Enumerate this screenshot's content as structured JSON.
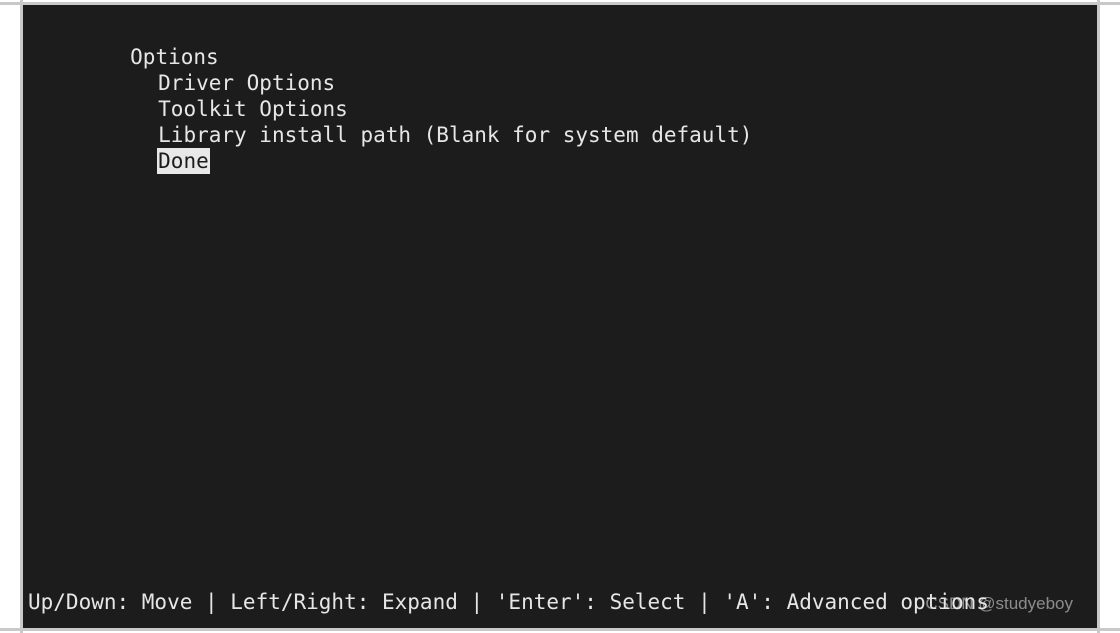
{
  "terminal": {
    "background_color": "#1c1c1c",
    "text_color": "#e6e6e6",
    "border_color": "#c9c9c9",
    "highlight_background": "#e8e8e8",
    "highlight_text_color": "#1c1c1c"
  },
  "menu": {
    "title": "Options",
    "items": [
      {
        "label": "Options",
        "indent": 0,
        "selected": false
      },
      {
        "label": "Driver Options",
        "indent": 1,
        "selected": false
      },
      {
        "label": "Toolkit Options",
        "indent": 1,
        "selected": false
      },
      {
        "label": "Library install path (Blank for system default)",
        "indent": 1,
        "selected": false
      },
      {
        "label": "Done",
        "indent": 1,
        "selected": true
      }
    ]
  },
  "help_bar": {
    "text": "Up/Down: Move | Left/Right: Expand | 'Enter': Select | 'A': Advanced options",
    "hints": [
      {
        "keys": "Up/Down",
        "action": "Move"
      },
      {
        "keys": "Left/Right",
        "action": "Expand"
      },
      {
        "keys": "'Enter'",
        "action": "Select"
      },
      {
        "keys": "'A'",
        "action": "Advanced options"
      }
    ]
  },
  "watermark": {
    "text": "CSDN @studyeboy"
  }
}
